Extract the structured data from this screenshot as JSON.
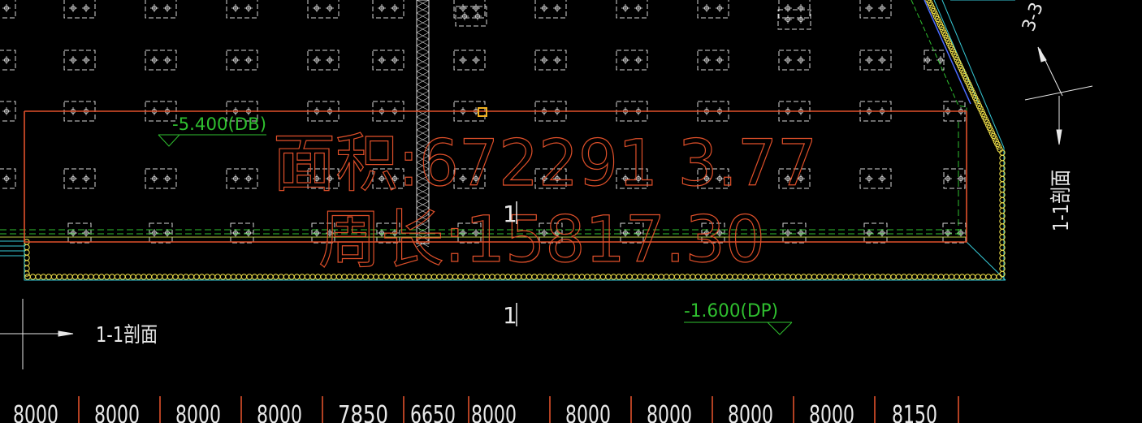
{
  "drawing": {
    "area_label": "面积:672291 3.77",
    "perimeter_label": "周长:15817.30",
    "level_top": "-5.400(DB)",
    "level_bottom": "-1.600(DP)",
    "section_mark_1": "1",
    "section_mark_2": "1",
    "section_label_left": "1-1剖面",
    "section_label_right": "1-1剖面",
    "section_label_corner": "3-3",
    "dimensions": [
      "8000",
      "8000",
      "8000",
      "8000",
      "7850",
      "6650",
      "8000",
      "8000",
      "8000",
      "8000",
      "8000",
      "8150"
    ]
  },
  "colors": {
    "background": "#000000",
    "boundary_orange": "#e0502a",
    "grid_white": "#d8d8d8",
    "green": "#2fbf2f",
    "yellow": "#f2e24a",
    "cyan": "#36c9d6",
    "grip": "#f0b020"
  }
}
